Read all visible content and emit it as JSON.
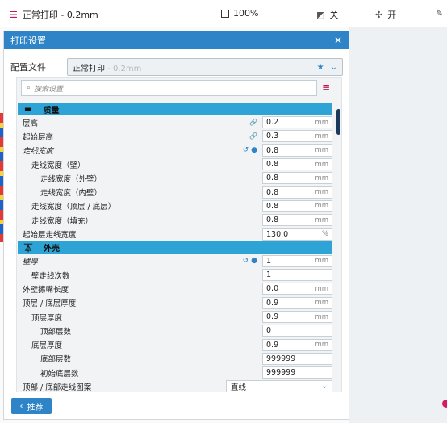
{
  "topbar": {
    "profile": "正常打印 - 0.2mm",
    "zoom": "100%",
    "support": "关",
    "adhesion": "开"
  },
  "panel": {
    "title": "打印设置",
    "profile_label": "配置文件",
    "profile_name": "正常打印",
    "profile_sub": " - 0.2mm",
    "search_placeholder": "搜索设置",
    "recommend_label": "推荐"
  },
  "sections": [
    {
      "title": "质量",
      "rows": [
        {
          "label": "层高",
          "value": "0.2",
          "unit": "mm",
          "indent": 0,
          "link": true
        },
        {
          "label": "起始层高",
          "value": "0.3",
          "unit": "mm",
          "indent": 0,
          "link": true
        },
        {
          "label": "走线宽度",
          "value": "0.8",
          "unit": "mm",
          "indent": 0,
          "italic": true,
          "reset": true
        },
        {
          "label": "走线宽度（壁）",
          "value": "0.8",
          "unit": "mm",
          "indent": 1
        },
        {
          "label": "走线宽度（外壁）",
          "value": "0.8",
          "unit": "mm",
          "indent": 2
        },
        {
          "label": "走线宽度（内壁）",
          "value": "0.8",
          "unit": "mm",
          "indent": 2
        },
        {
          "label": "走线宽度（顶层 / 底层）",
          "value": "0.8",
          "unit": "mm",
          "indent": 1
        },
        {
          "label": "走线宽度（填充）",
          "value": "0.8",
          "unit": "mm",
          "indent": 1
        },
        {
          "label": "起始层走线宽度",
          "value": "130.0",
          "unit": "%",
          "indent": 0
        }
      ]
    },
    {
      "title": "外壳",
      "rows": [
        {
          "label": "壁厚",
          "value": "1",
          "unit": "mm",
          "indent": 0,
          "italic": true,
          "reset": true
        },
        {
          "label": "壁走线次数",
          "value": "1",
          "unit": "",
          "indent": 1
        },
        {
          "label": "外壁擦嘴长度",
          "value": "0.0",
          "unit": "mm",
          "indent": 0
        },
        {
          "label": "顶层 / 底层厚度",
          "value": "0.9",
          "unit": "mm",
          "indent": 0
        },
        {
          "label": "顶层厚度",
          "value": "0.9",
          "unit": "mm",
          "indent": 1
        },
        {
          "label": "顶部层数",
          "value": "0",
          "unit": "",
          "indent": 2
        },
        {
          "label": "底层厚度",
          "value": "0.9",
          "unit": "mm",
          "indent": 1
        },
        {
          "label": "底部层数",
          "value": "999999",
          "unit": "",
          "indent": 2
        },
        {
          "label": "初始底层数",
          "value": "999999",
          "unit": "",
          "indent": 2
        },
        {
          "label": "顶部 / 底部走线图案",
          "value": "直线",
          "unit": "",
          "indent": 0,
          "dropdown": true
        }
      ]
    }
  ]
}
